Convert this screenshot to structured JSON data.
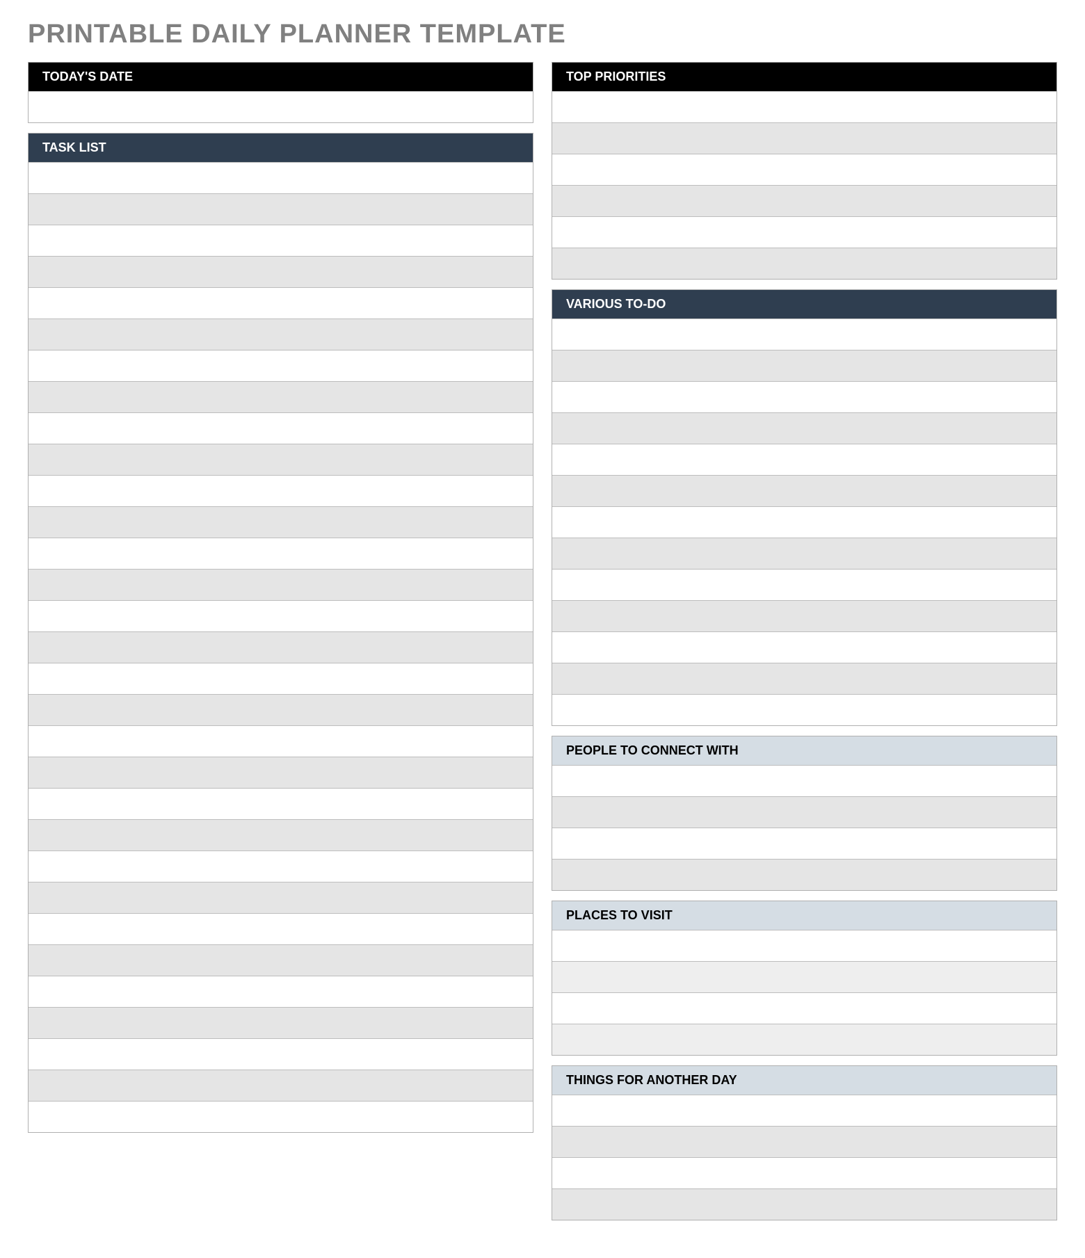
{
  "title": "PRINTABLE DAILY PLANNER TEMPLATE",
  "left": {
    "todays_date": {
      "header": "TODAY'S DATE",
      "rows": [
        ""
      ]
    },
    "task_list": {
      "header": "TASK LIST",
      "rows": [
        "",
        "",
        "",
        "",
        "",
        "",
        "",
        "",
        "",
        "",
        "",
        "",
        "",
        "",
        "",
        "",
        "",
        "",
        "",
        "",
        "",
        "",
        "",
        "",
        "",
        "",
        "",
        "",
        "",
        "",
        ""
      ]
    }
  },
  "right": {
    "top_priorities": {
      "header": "TOP PRIORITIES",
      "rows": [
        "",
        "",
        "",
        "",
        "",
        ""
      ]
    },
    "various_todo": {
      "header": "VARIOUS TO-DO",
      "rows": [
        "",
        "",
        "",
        "",
        "",
        "",
        "",
        "",
        "",
        "",
        "",
        "",
        ""
      ]
    },
    "people": {
      "header": "PEOPLE TO CONNECT WITH",
      "rows": [
        "",
        "",
        "",
        ""
      ]
    },
    "places": {
      "header": "PLACES TO VISIT",
      "rows": [
        "",
        "",
        "",
        ""
      ]
    },
    "another_day": {
      "header": "THINGS FOR ANOTHER DAY",
      "rows": [
        "",
        "",
        "",
        ""
      ]
    }
  },
  "colors": {
    "black": "#000000",
    "navy": "#2f3e50",
    "light": "#d5dde4",
    "alt_grey": "#e5e5e5",
    "alt_light": "#eeeeee"
  }
}
